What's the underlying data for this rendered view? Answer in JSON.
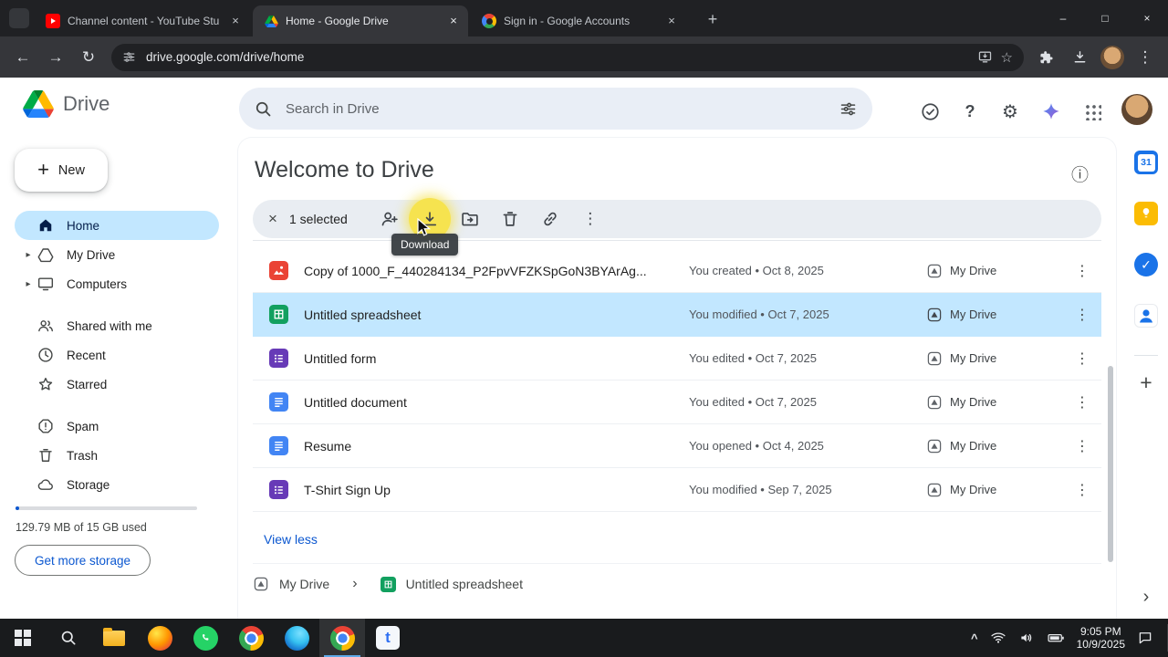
{
  "browser": {
    "tabs": [
      {
        "title": "Channel content - YouTube Stu"
      },
      {
        "title": "Home - Google Drive"
      },
      {
        "title": "Sign in - Google Accounts"
      }
    ],
    "url": "drive.google.com/drive/home"
  },
  "drive": {
    "brand": "Drive",
    "search": {
      "placeholder": "Search in Drive"
    },
    "sidebar": {
      "new_button": "New",
      "items": [
        {
          "label": "Home"
        },
        {
          "label": "My Drive"
        },
        {
          "label": "Computers"
        },
        {
          "label": "Shared with me"
        },
        {
          "label": "Recent"
        },
        {
          "label": "Starred"
        },
        {
          "label": "Spam"
        },
        {
          "label": "Trash"
        },
        {
          "label": "Storage"
        }
      ],
      "storage_used": "129.79 MB of 15 GB used",
      "get_more_storage": "Get more storage"
    },
    "main": {
      "title": "Welcome to Drive",
      "toolbar": {
        "selected_count": "1 selected",
        "tooltip": "Download"
      },
      "files": [
        {
          "name": "Copy of 1000_F_440284134_P2FpvVFZKSpGoN3BYArAg...",
          "type": "image",
          "meta": "You created • Oct 8, 2025",
          "location": "My Drive"
        },
        {
          "name": "Untitled spreadsheet",
          "type": "spreadsheet",
          "meta": "You modified • Oct 7, 2025",
          "location": "My Drive",
          "selected": true
        },
        {
          "name": "Untitled form",
          "type": "form",
          "meta": "You edited • Oct 7, 2025",
          "location": "My Drive"
        },
        {
          "name": "Untitled document",
          "type": "document",
          "meta": "You edited • Oct 7, 2025",
          "location": "My Drive"
        },
        {
          "name": "Resume",
          "type": "document",
          "meta": "You opened • Oct 4, 2025",
          "location": "My Drive"
        },
        {
          "name": "T-Shirt Sign Up",
          "type": "form",
          "meta": "You modified • Sep 7, 2025",
          "location": "My Drive"
        }
      ],
      "view_less": "View less",
      "breadcrumb": {
        "root": "My Drive",
        "current": "Untitled spreadsheet"
      }
    }
  },
  "taskbar": {
    "time": "9:05 PM",
    "date": "10/9/2025"
  },
  "icons": {
    "close": "×",
    "minimize": "–",
    "maximize": "□",
    "back": "←",
    "forward": "→",
    "reload": "↻",
    "star": "☆",
    "plus": "+",
    "more": "⋮",
    "help": "?",
    "settings": "⚙",
    "info": "ⓘ",
    "caret": "▸",
    "chevron_right": "›",
    "chevron_up": "^",
    "check": "✓",
    "calendar_day": "31",
    "pinned_app_letter": "t"
  }
}
